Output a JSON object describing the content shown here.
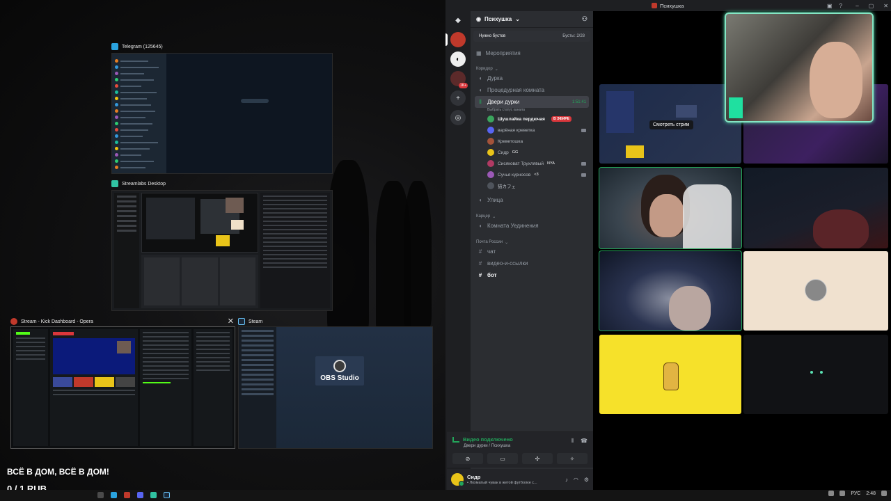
{
  "switcher": {
    "telegram": {
      "title": "Telegram (125645)"
    },
    "streamlabs": {
      "title": "Streamlabs Desktop"
    },
    "kick": {
      "title": "Stream - Kick Dashboard - Opera"
    },
    "steam": {
      "title": "Steam",
      "featured_app": "OBS Studio"
    }
  },
  "stream_overlay": {
    "headline": "ВСЁ В ДОМ, ВСЁ В ДОМ!",
    "donation_counter": "0 / 1 RUB"
  },
  "taskbar": {
    "language": "РУС",
    "time": "2:48"
  },
  "app_window": {
    "title": "Психушка"
  },
  "server": {
    "name": "Психушка",
    "boost_label": "Нужно бустов",
    "boost_progress": "Бусты: 2/28",
    "events_label": "Мероприятия"
  },
  "categories": [
    {
      "name": "Коридор",
      "channels": [
        {
          "name": "Дурка",
          "type": "voice"
        },
        {
          "name": "Процедурная комната",
          "type": "voice"
        },
        {
          "name": "Двери дурки",
          "type": "voice",
          "active": true,
          "timer": "1:51:41",
          "status_hint": "Выбрать статус канала"
        }
      ]
    },
    {
      "name": "Карцер",
      "channels": [
        {
          "name": "Улица",
          "type": "voice"
        },
        {
          "name": "Комната Уединения",
          "type": "voice"
        }
      ]
    },
    {
      "name": "Почта России",
      "channels": [
        {
          "name": "чат",
          "type": "text"
        },
        {
          "name": "видео-и-ссылки",
          "type": "text"
        },
        {
          "name": "бот",
          "type": "text",
          "unread": true
        }
      ]
    }
  ],
  "voice_members": [
    {
      "name": "Шушлайка пердючая",
      "live_badge": "В ЭФИРЕ",
      "color": "#3ba55d"
    },
    {
      "name": "варёная креветка",
      "color": "#5865f2"
    },
    {
      "name": "Креветошка",
      "color": "#a3533a"
    },
    {
      "name": "Сидр",
      "tag": "GG",
      "color": "#e9c419"
    },
    {
      "name": "Сисяковат Трухлявый",
      "tag": "NYA",
      "color": "#b13a63"
    },
    {
      "name": "Сучья курносов",
      "tag": "<3",
      "color": "#9b59b6"
    },
    {
      "name": "猫カフェ",
      "color": "#4f545c"
    }
  ],
  "voice_panel": {
    "status": "Видео подключено",
    "channel_path": "Двери дурки / Психушка"
  },
  "user": {
    "name": "Сидр",
    "status": "• Лохматый чувак в жетой футболке с..."
  },
  "stage": {
    "watch_stream_label": "Смотреть стрим"
  },
  "colors": {
    "accent_green": "#23a55a",
    "live_red": "#da373c",
    "pip_border": "#84e6c4"
  }
}
